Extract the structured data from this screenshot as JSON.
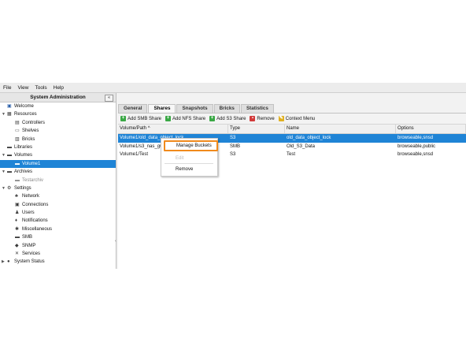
{
  "menubar": [
    "File",
    "View",
    "Tools",
    "Help"
  ],
  "left_panel": {
    "title": "System Administration",
    "collapse": "«"
  },
  "tree": [
    {
      "label": "Welcome",
      "depth": 0,
      "twisty": "",
      "icon": "monitor-icon",
      "glyph": "▣",
      "color": "#2b5fa8"
    },
    {
      "label": "Resources",
      "depth": 0,
      "twisty": "▼",
      "icon": "grid-icon",
      "glyph": "▦",
      "color": "#3a3a3a"
    },
    {
      "label": "Controllers",
      "depth": 1,
      "twisty": "",
      "icon": "server-icon",
      "glyph": "▤",
      "color": "#3a3a3a"
    },
    {
      "label": "Shelves",
      "depth": 1,
      "twisty": "",
      "icon": "shelf-icon",
      "glyph": "▭",
      "color": "#3a3a3a"
    },
    {
      "label": "Bricks",
      "depth": 1,
      "twisty": "",
      "icon": "brick-icon",
      "glyph": "▥",
      "color": "#3a3a3a"
    },
    {
      "label": "Libraries",
      "depth": 0,
      "twisty": "",
      "icon": "library-icon",
      "glyph": "▬",
      "color": "#3a3a3a"
    },
    {
      "label": "Volumes",
      "depth": 0,
      "twisty": "▼",
      "icon": "volume-icon",
      "glyph": "▬",
      "color": "#3a3a3a"
    },
    {
      "label": "Volume1",
      "depth": 1,
      "twisty": "",
      "icon": "volume-icon",
      "glyph": "▬",
      "color": "#ffffff",
      "selected": true
    },
    {
      "label": "Archives",
      "depth": 0,
      "twisty": "▼",
      "icon": "archive-icon",
      "glyph": "▬",
      "color": "#3a3a3a"
    },
    {
      "label": "Testarchiv",
      "depth": 1,
      "twisty": "",
      "icon": "archive-icon",
      "glyph": "▬",
      "color": "#8a8a8a",
      "muted": true
    },
    {
      "label": "Settings",
      "depth": 0,
      "twisty": "▼",
      "icon": "gear-icon",
      "glyph": "⚙",
      "color": "#3a3a3a"
    },
    {
      "label": "Network",
      "depth": 1,
      "twisty": "",
      "icon": "network-icon",
      "glyph": "♣",
      "color": "#3a3a3a"
    },
    {
      "label": "Connections",
      "depth": 1,
      "twisty": "",
      "icon": "connections-icon",
      "glyph": "▣",
      "color": "#3a3a3a"
    },
    {
      "label": "Users",
      "depth": 1,
      "twisty": "",
      "icon": "user-icon",
      "glyph": "♟",
      "color": "#3a3a3a"
    },
    {
      "label": "Notifications",
      "depth": 1,
      "twisty": "",
      "icon": "bell-icon",
      "glyph": "♦",
      "color": "#3a3a3a"
    },
    {
      "label": "Miscellaneous",
      "depth": 1,
      "twisty": "",
      "icon": "misc-icon",
      "glyph": "✱",
      "color": "#3a3a3a"
    },
    {
      "label": "SMB",
      "depth": 1,
      "twisty": "",
      "icon": "smb-icon",
      "glyph": "▬",
      "color": "#3a3a3a"
    },
    {
      "label": "SNMP",
      "depth": 1,
      "twisty": "",
      "icon": "snmp-icon",
      "glyph": "◆",
      "color": "#3a3a3a"
    },
    {
      "label": "Services",
      "depth": 1,
      "twisty": "",
      "icon": "wrench-icon",
      "glyph": "✕",
      "color": "#3a3a3a"
    },
    {
      "label": "System Status",
      "depth": 0,
      "twisty": "▶",
      "icon": "info-icon",
      "glyph": "●",
      "color": "#3a3a3a"
    }
  ],
  "tabs": [
    {
      "label": "General",
      "active": false
    },
    {
      "label": "Shares",
      "active": true
    },
    {
      "label": "Snapshots",
      "active": false
    },
    {
      "label": "Bricks",
      "active": false
    },
    {
      "label": "Statistics",
      "active": false
    }
  ],
  "toolbar": [
    {
      "label": "Add SMB Share",
      "icon": "plus-icon",
      "glyph": "+",
      "color": "#3aa845"
    },
    {
      "label": "Add NFS Share",
      "icon": "plus-icon",
      "glyph": "+",
      "color": "#3aa845"
    },
    {
      "label": "Add S3 Share",
      "icon": "plus-icon",
      "glyph": "+",
      "color": "#3aa845"
    },
    {
      "label": "Remove",
      "icon": "trash-icon",
      "glyph": "▪",
      "color": "#d23a3a"
    },
    {
      "label": "Context Menu",
      "icon": "pencil-icon",
      "glyph": "✎",
      "color": "#e0b020"
    }
  ],
  "columns": [
    "Volume/Path ^",
    "Type",
    "Name",
    "Options"
  ],
  "rows": [
    {
      "path": "Volume1/old_data_object_lock",
      "type": "S3",
      "name": "old_data_object_lock",
      "options": "browseable,snsd",
      "selected": true
    },
    {
      "path": "Volume1/s3_nas_gw",
      "type": "SMB",
      "name": "Old_S3_Data",
      "options": "browseable,public",
      "selected": false
    },
    {
      "path": "Volume1/Test",
      "type": "S3",
      "name": "Test",
      "options": "browseable,snsd",
      "selected": false
    }
  ],
  "context_menu": {
    "manage": "Manage Buckets",
    "edit": "Edit",
    "remove": "Remove"
  }
}
